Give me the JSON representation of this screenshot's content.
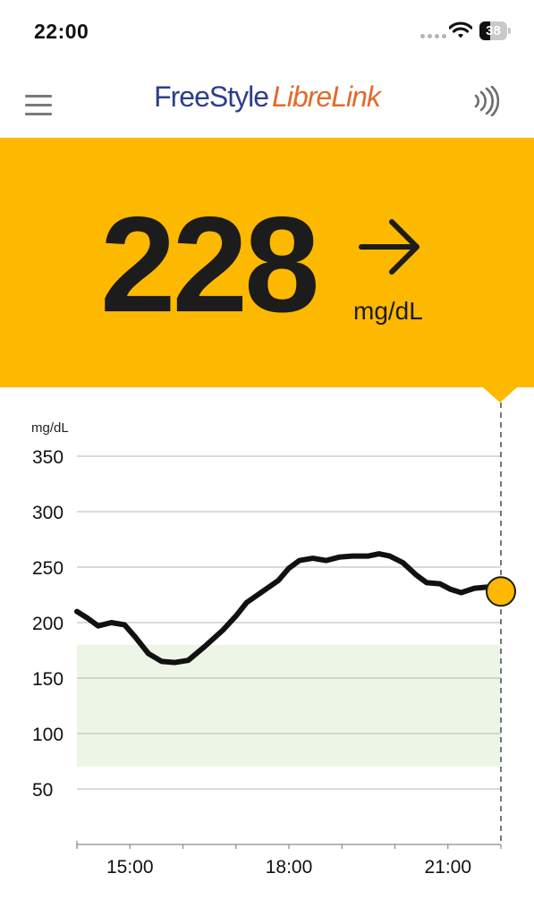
{
  "status_bar": {
    "time": "22:00",
    "battery_percent": "38",
    "battery_level": 0.38,
    "wifi_icon": "wifi-icon",
    "signal_icon": "cell-signal-icon"
  },
  "header": {
    "menu_icon": "hamburger-menu-icon",
    "logo_part1": "FreeStyle",
    "logo_part2": "LibreLink",
    "nfc_icon": "nfc-scan-icon"
  },
  "reading": {
    "value": "228",
    "unit": "mg/dL",
    "trend_icon": "arrow-right-icon",
    "panel_color": "#fdb800"
  },
  "chart_data": {
    "type": "line",
    "ylabel": "mg/dL",
    "yticks": [
      50,
      100,
      150,
      200,
      250,
      300,
      350
    ],
    "ylim": [
      0,
      350
    ],
    "xticks": [
      "15:00",
      "18:00",
      "21:00"
    ],
    "x_range_hours": [
      14.0,
      22.0
    ],
    "target_range": [
      70,
      180
    ],
    "target_color": "#edf6e6",
    "line_color": "#111111",
    "marker_color": "#fdb800",
    "grid": true,
    "series": [
      {
        "x": [
          14.0,
          14.2,
          14.4,
          14.65,
          14.9,
          15.1,
          15.35,
          15.6,
          15.85,
          16.1,
          16.4,
          16.75,
          17.0,
          17.2,
          17.5,
          17.8,
          18.0,
          18.2,
          18.45,
          18.7,
          18.95,
          19.2,
          19.5,
          19.7,
          19.9,
          20.15,
          20.4,
          20.6,
          20.85,
          21.05,
          21.25,
          21.5,
          21.75,
          22.0
        ],
        "y": [
          210,
          204,
          197,
          200,
          198,
          187,
          172,
          165,
          164,
          166,
          178,
          193,
          206,
          218,
          228,
          238,
          249,
          256,
          258,
          256,
          259,
          260,
          260,
          262,
          260,
          254,
          243,
          236,
          235,
          230,
          227,
          231,
          232,
          228
        ]
      }
    ],
    "current_value": 228
  }
}
